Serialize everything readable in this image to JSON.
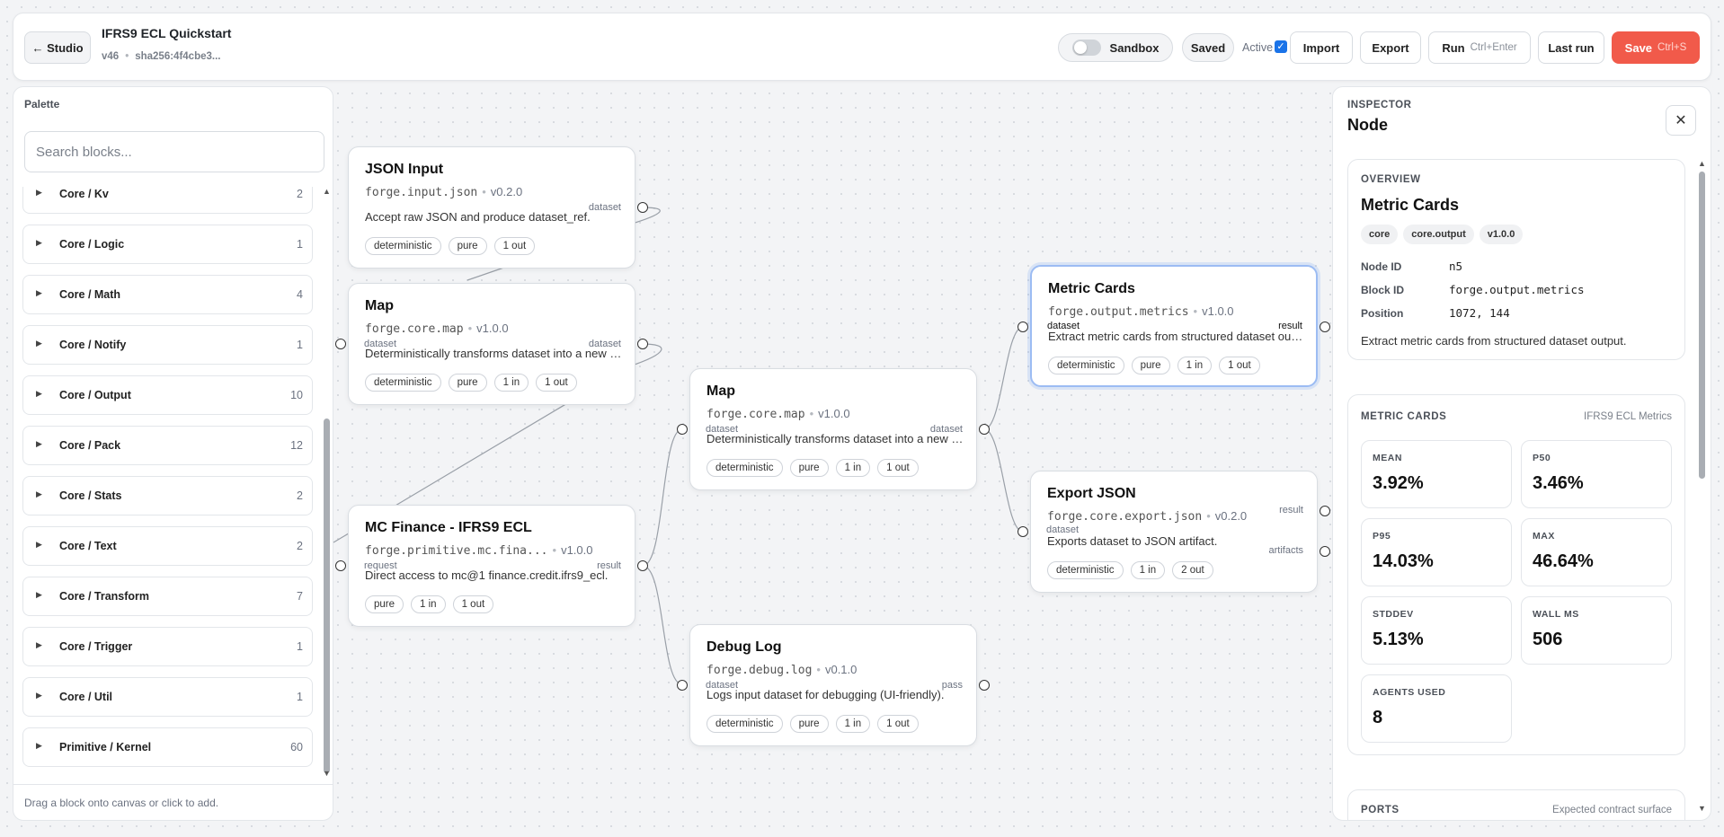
{
  "header": {
    "back_label": "← Studio",
    "title": "IFRS9 ECL Quickstart",
    "version": "v46",
    "hash": "sha256:4f4cbe3...",
    "sandbox_label": "Sandbox",
    "sandbox_on": false,
    "saved_label": "Saved",
    "active_label": "Active",
    "active_checked": true,
    "import_label": "Import",
    "export_label": "Export",
    "run_label": "Run",
    "run_shortcut": "Ctrl+Enter",
    "last_run_label": "Last run",
    "save_label": "Save",
    "save_shortcut": "Ctrl+S",
    "save_color": "#f15a4a"
  },
  "palette": {
    "title": "Palette",
    "search_placeholder": "Search blocks...",
    "categories": [
      {
        "name": "Core / Kv",
        "count": "2"
      },
      {
        "name": "Core / Logic",
        "count": "1"
      },
      {
        "name": "Core / Math",
        "count": "4"
      },
      {
        "name": "Core / Notify",
        "count": "1"
      },
      {
        "name": "Core / Output",
        "count": "10"
      },
      {
        "name": "Core / Pack",
        "count": "12"
      },
      {
        "name": "Core / Stats",
        "count": "2"
      },
      {
        "name": "Core / Text",
        "count": "2"
      },
      {
        "name": "Core / Transform",
        "count": "7"
      },
      {
        "name": "Core / Trigger",
        "count": "1"
      },
      {
        "name": "Core / Util",
        "count": "1"
      },
      {
        "name": "Primitive / Kernel",
        "count": "60"
      }
    ],
    "footer": "Drag a block onto canvas or click to add."
  },
  "nodes": {
    "json_input": {
      "title": "JSON Input",
      "block": "forge.input.json",
      "version": "v0.2.0",
      "desc": "Accept raw JSON and produce dataset_ref.",
      "tags": [
        "deterministic",
        "pure",
        "1 out"
      ],
      "out_port": "dataset"
    },
    "map1": {
      "title": "Map",
      "block": "forge.core.map",
      "version": "v1.0.0",
      "desc": "Deterministically transforms dataset into a new dataset.",
      "tags": [
        "deterministic",
        "pure",
        "1 in",
        "1 out"
      ],
      "in_port": "dataset",
      "out_port": "dataset"
    },
    "mc_finance": {
      "title": "MC Finance - IFRS9 ECL",
      "block": "forge.primitive.mc.fina...",
      "version": "v1.0.0",
      "desc": "Direct access to mc@1 finance.credit.ifrs9_ecl.",
      "tags": [
        "pure",
        "1 in",
        "1 out"
      ],
      "in_port": "request",
      "out_port": "result"
    },
    "map2": {
      "title": "Map",
      "block": "forge.core.map",
      "version": "v1.0.0",
      "desc": "Deterministically transforms dataset into a new dataset.",
      "tags": [
        "deterministic",
        "pure",
        "1 in",
        "1 out"
      ],
      "in_port": "dataset",
      "out_port": "dataset"
    },
    "debug_log": {
      "title": "Debug Log",
      "block": "forge.debug.log",
      "version": "v0.1.0",
      "desc": "Logs input dataset for debugging (UI-friendly).",
      "tags": [
        "deterministic",
        "pure",
        "1 in",
        "1 out"
      ],
      "in_port": "dataset",
      "out_port": "pass"
    },
    "metric_cards": {
      "title": "Metric Cards",
      "block": "forge.output.metrics",
      "version": "v1.0.0",
      "desc": "Extract metric cards from structured dataset output.",
      "tags": [
        "deterministic",
        "pure",
        "1 in",
        "1 out"
      ],
      "in_port": "dataset",
      "out_port": "result"
    },
    "export_json": {
      "title": "Export JSON",
      "block": "forge.core.export.json",
      "version": "v0.2.0",
      "desc": "Exports dataset to JSON artifact.",
      "tags": [
        "deterministic",
        "1 in",
        "2 out"
      ],
      "in_port": "dataset",
      "out_port_1": "result",
      "out_port_2": "artifacts"
    }
  },
  "inspector": {
    "eyebrow": "INSPECTOR",
    "title": "Node",
    "overview": {
      "eyebrow": "OVERVIEW",
      "name": "Metric Cards",
      "tags": [
        "core",
        "core.output",
        "v1.0.0"
      ],
      "node_id_label": "Node ID",
      "node_id": "n5",
      "block_id_label": "Block ID",
      "block_id": "forge.output.metrics",
      "position_label": "Position",
      "position": "1072, 144",
      "desc": "Extract metric cards from structured dataset output."
    },
    "metrics": {
      "eyebrow": "METRIC CARDS",
      "note": "IFRS9 ECL Metrics",
      "cards": [
        {
          "label": "MEAN",
          "value": "3.92%"
        },
        {
          "label": "P50",
          "value": "3.46%"
        },
        {
          "label": "P95",
          "value": "14.03%"
        },
        {
          "label": "MAX",
          "value": "46.64%"
        },
        {
          "label": "STDDEV",
          "value": "5.13%"
        },
        {
          "label": "WALL MS",
          "value": "506"
        },
        {
          "label": "AGENTS USED",
          "value": "8"
        }
      ]
    },
    "ports": {
      "eyebrow": "PORTS",
      "note": "Expected contract surface"
    }
  }
}
